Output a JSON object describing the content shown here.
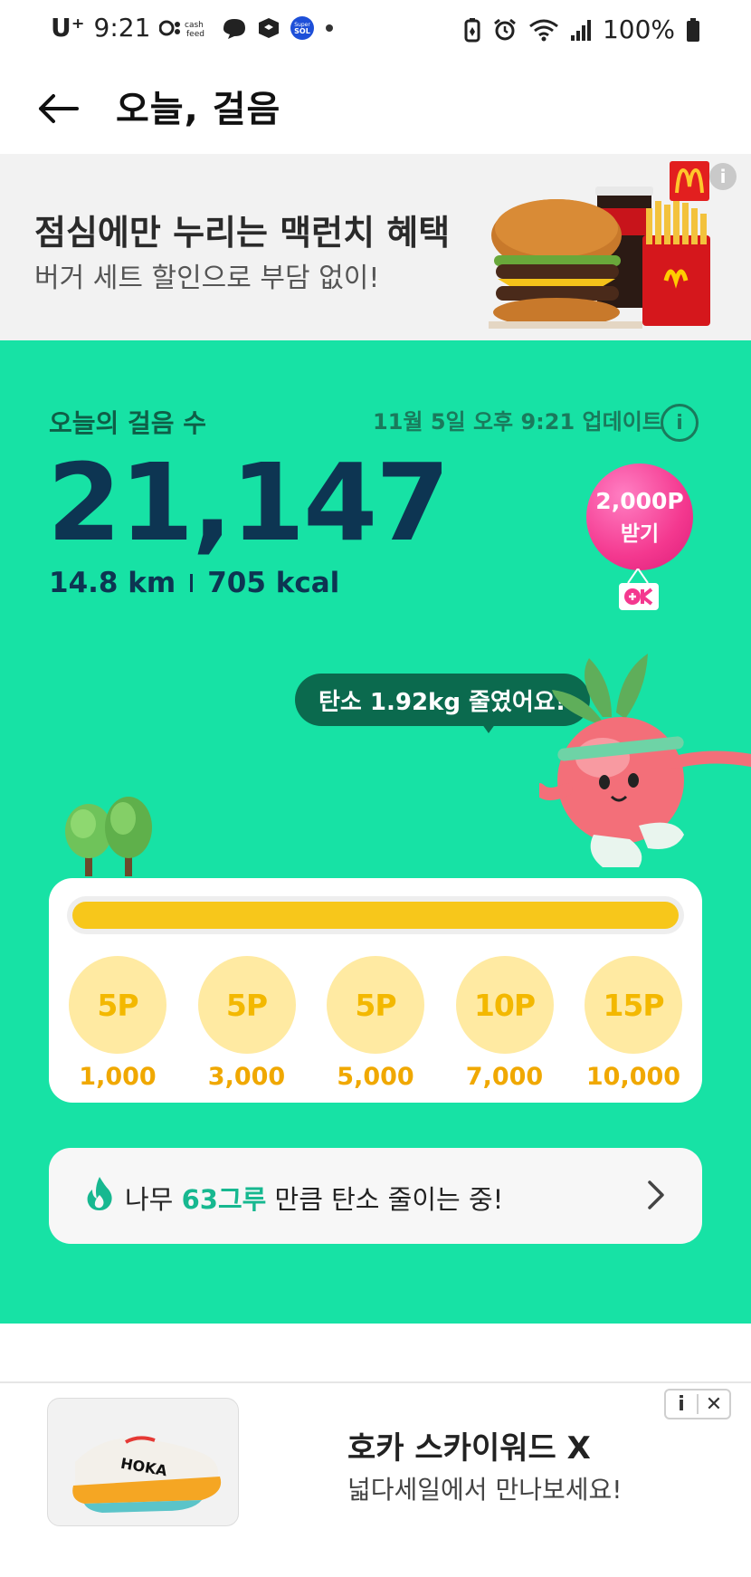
{
  "status_bar": {
    "carrier": "U⁺",
    "time": "9:21",
    "app_label_cash": "cash feed",
    "app_label_sol": "Super SOL",
    "battery": "100%"
  },
  "header": {
    "title": "오늘, 걸음"
  },
  "ad_top": {
    "title": "점심에만 누리는 맥런치 혜택",
    "subtitle": "버거 세트 할인으로 부담 없이!",
    "info": "i",
    "brand_mark": "M"
  },
  "today": {
    "label": "오늘의 걸음 수",
    "updated": "11월 5일 오후 9:21 업데이트",
    "steps": "21,147",
    "distance": "14.8 km",
    "calories": "705 kcal",
    "reward_amount": "2,000P",
    "reward_action": "받기",
    "reward_tag": "OK",
    "speech": "탄소 1.92kg 줄였어요!"
  },
  "progress": {
    "fraction": 1.0
  },
  "milestones": [
    {
      "points": "5P",
      "steps": "1,000"
    },
    {
      "points": "5P",
      "steps": "3,000"
    },
    {
      "points": "5P",
      "steps": "5,000"
    },
    {
      "points": "10P",
      "steps": "7,000"
    },
    {
      "points": "15P",
      "steps": "10,000"
    }
  ],
  "carbon": {
    "prefix": "나무 ",
    "highlight": "63그루",
    "suffix": " 만큼 탄소 줄이는 중!"
  },
  "ad_bottom": {
    "title": "호카 스카이워드 X",
    "subtitle": "넓다세일에서 만나보세요!",
    "info": "i",
    "close": "✕",
    "shoe_brand": "HOKA"
  },
  "colors": {
    "green_bg": "#17e2a5",
    "navy": "#0d3552",
    "progress_yellow": "#f7c71b",
    "coin_bg": "#ffeaa2",
    "balloon_pink": "#f4388f",
    "highlight_teal": "#17b890"
  }
}
